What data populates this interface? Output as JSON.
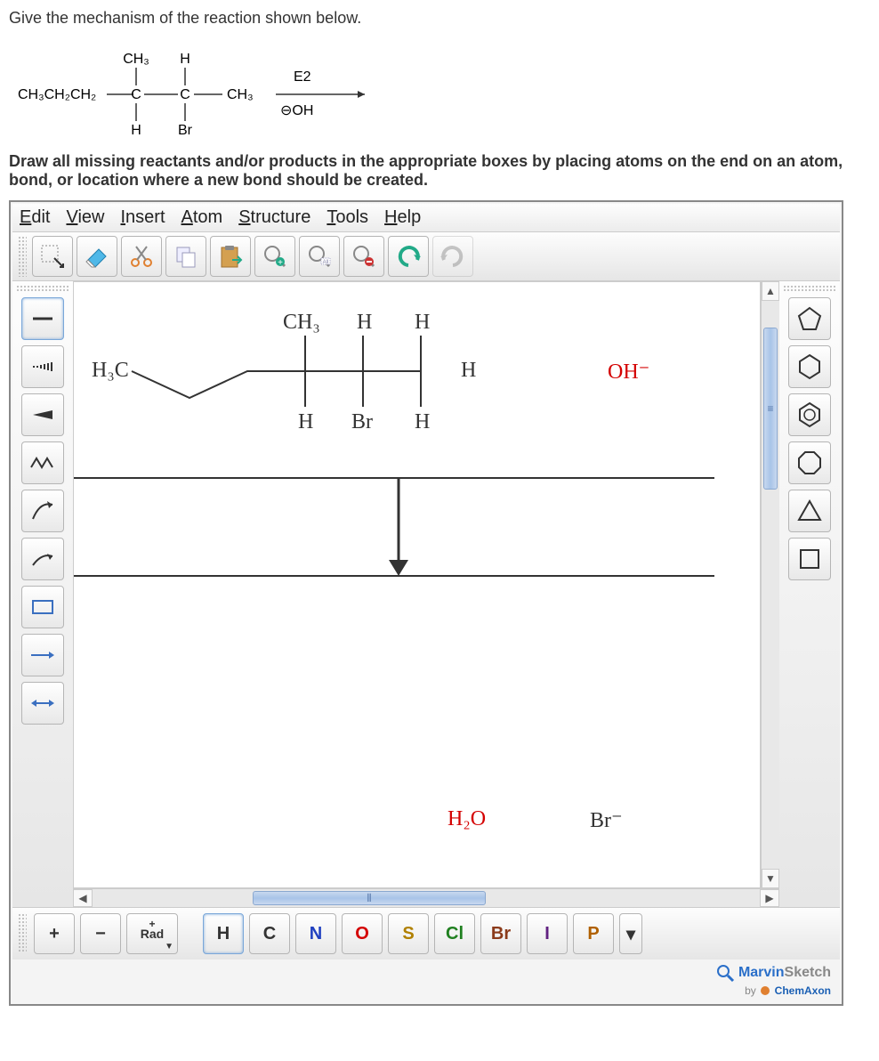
{
  "question": "Give the mechanism of the reaction shown below.",
  "instruction": "Draw all missing reactants and/or products in the appropriate boxes by placing atoms on the end on an atom, bond, or location where a new bond should be created.",
  "reaction": {
    "left_group": "CH₃CH₂CH₂",
    "c1_top": "CH₃",
    "c1_bot": "H",
    "c2_top": "H",
    "c2_bot": "Br",
    "right_group": "CH₃",
    "arrow_top": "E2",
    "arrow_bot": "⊖OH"
  },
  "menu": {
    "edit": "Edit",
    "view": "View",
    "insert": "Insert",
    "atom": "Atom",
    "structure": "Structure",
    "tools": "Tools",
    "help": "Help"
  },
  "canvas": {
    "h3c": "H₃C",
    "ch3": "CH₃",
    "h": "H",
    "br": "Br",
    "oh_minus": "OH⁻",
    "h2o": "H₂O",
    "br_minus": "Br⁻"
  },
  "atom_buttons": {
    "plus": "+",
    "minus": "−",
    "rad": "Rad",
    "H": "H",
    "C": "C",
    "N": "N",
    "O": "O",
    "S": "S",
    "Cl": "Cl",
    "Br": "Br",
    "I": "I",
    "P": "P"
  },
  "atom_colors": {
    "H": "#333333",
    "C": "#333333",
    "N": "#2040c0",
    "O": "#d40000",
    "S": "#b08000",
    "Cl": "#208020",
    "Br": "#8b3a1a",
    "I": "#602080",
    "P": "#b06000"
  },
  "branding": {
    "marvin": "Marvin",
    "sketch": "Sketch",
    "by": "by",
    "chemaxon": "ChemAxon"
  }
}
